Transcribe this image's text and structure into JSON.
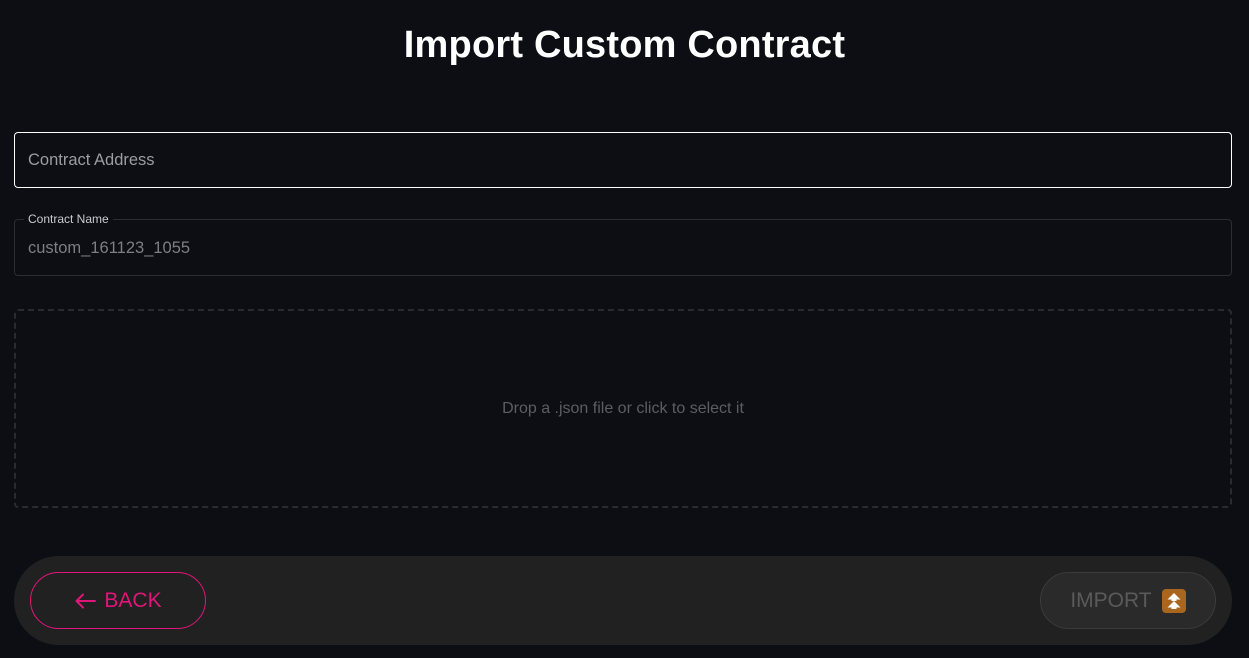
{
  "page": {
    "title": "Import Custom Contract"
  },
  "form": {
    "contract_address": {
      "placeholder": "Contract Address",
      "value": ""
    },
    "contract_name": {
      "label": "Contract Name",
      "value": "custom_161123_1055"
    },
    "dropzone": {
      "text": "Drop a .json file or click to select it"
    }
  },
  "actions": {
    "back_label": "BACK",
    "back_icon": "arrow-left-icon",
    "import_label": "IMPORT",
    "import_icon": "double-up-arrow-icon",
    "import_disabled": true
  },
  "colors": {
    "background": "#0d0e13",
    "accent": "#e0157a",
    "action_bar": "#212121",
    "import_icon_bg": "#a8661f"
  }
}
